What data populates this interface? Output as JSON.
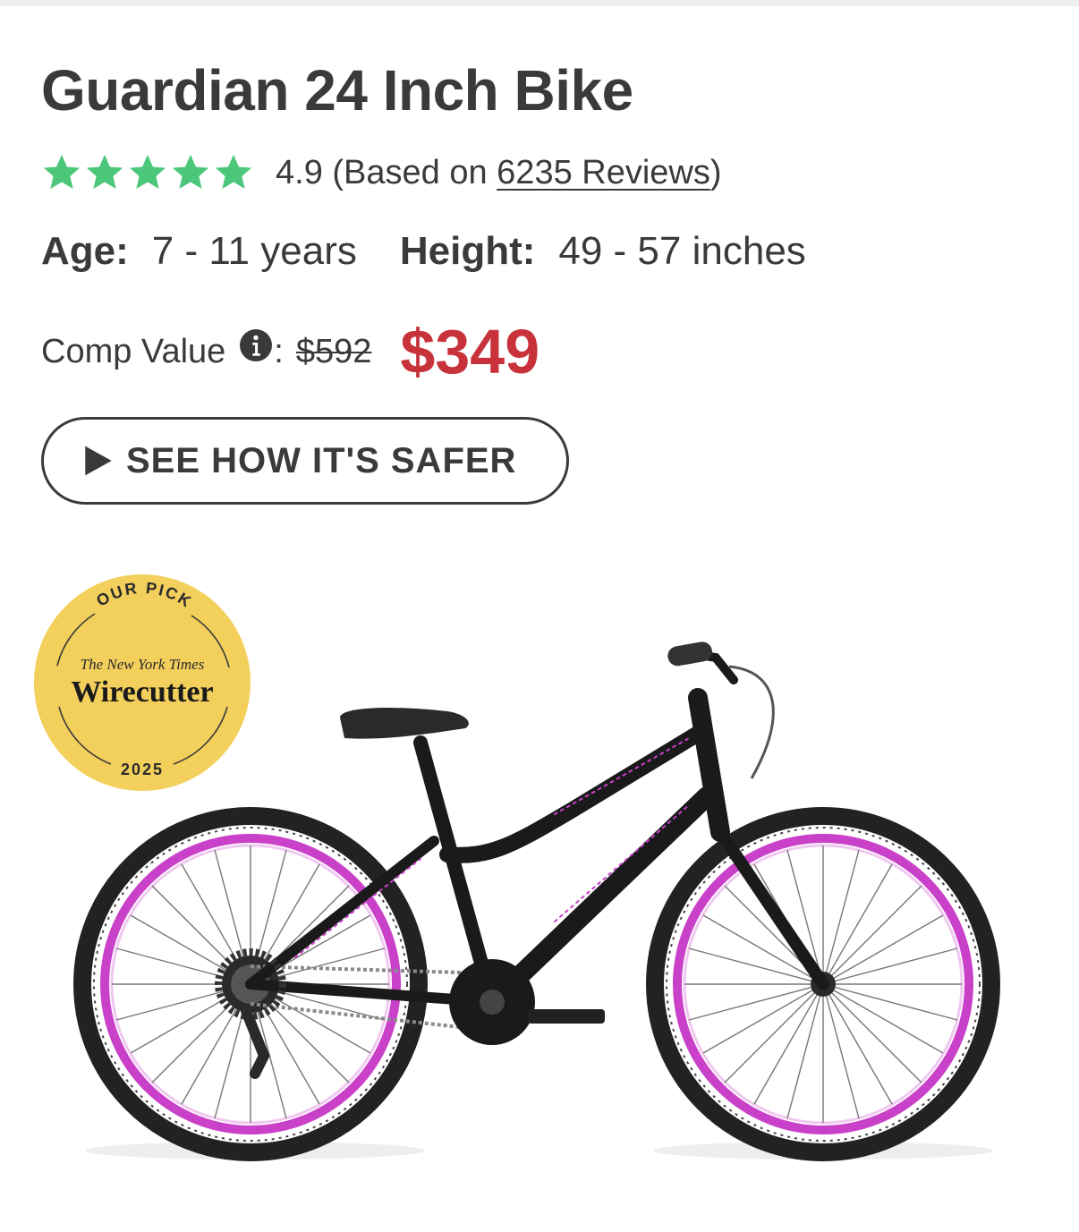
{
  "product": {
    "title": "Guardian 24 Inch Bike",
    "rating": {
      "stars": 5,
      "star_color": "#4cc77a",
      "score_text": "4.9 (Based on ",
      "reviews_link": "6235 Reviews",
      "close_paren": ")"
    },
    "specs": {
      "age_label": "Age:",
      "age_value": "7 - 11 years",
      "height_label": "Height:",
      "height_value": "49 - 57 inches"
    },
    "pricing": {
      "comp_label": "Comp Value",
      "colon": ":",
      "comp_price": "$592",
      "price": "$349",
      "price_color": "#c8323a"
    },
    "cta": {
      "label": "SEE HOW IT'S SAFER",
      "icon": "play-icon"
    },
    "badge": {
      "top_text": "OUR PICK",
      "publisher": "The New York Times",
      "brand": "Wirecutter",
      "year": "2025",
      "color": "#f3cf5c"
    },
    "image": {
      "rim_color": "#c940c9",
      "frame_color": "#1a1a1a"
    }
  }
}
